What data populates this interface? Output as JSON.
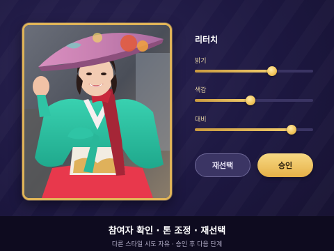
{
  "panel": {
    "title": "리터치",
    "sliders": [
      {
        "label": "밝기",
        "value": 0.65
      },
      {
        "label": "색감",
        "value": 0.47
      },
      {
        "label": "대비",
        "value": 0.82
      }
    ]
  },
  "buttons": {
    "reselect_label": "재선택",
    "approve_label": "승인"
  },
  "footer": {
    "title": "참여자 확인 · 톤 조정 · 재선택",
    "subtitle": "다른 스타일 시도 자유 · 승인 후 다음 단계"
  },
  "colors": {
    "accent_gold": "#e0b458",
    "background": "#1b1638",
    "track": "#3a3463"
  },
  "photo": {
    "icon": "participant-photo"
  }
}
